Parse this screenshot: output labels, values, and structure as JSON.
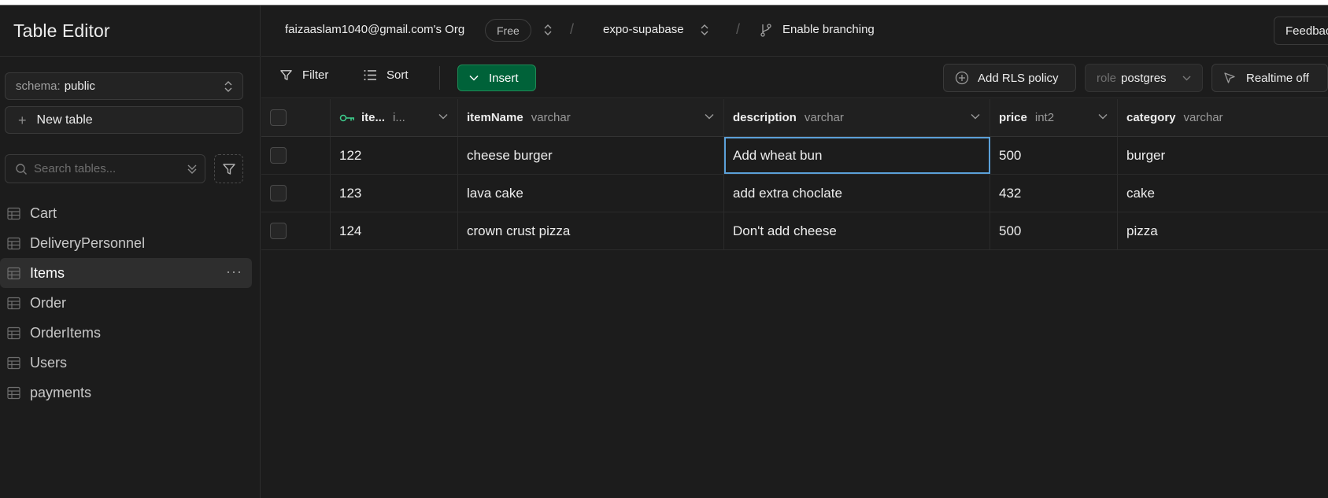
{
  "sidebar": {
    "title": "Table Editor",
    "schema": {
      "label": "schema:",
      "value": "public"
    },
    "new_table_label": "New table",
    "search_placeholder": "Search tables...",
    "tables": [
      {
        "name": "Cart",
        "active": false
      },
      {
        "name": "DeliveryPersonnel",
        "active": false
      },
      {
        "name": "Items",
        "active": true
      },
      {
        "name": "Order",
        "active": false
      },
      {
        "name": "OrderItems",
        "active": false
      },
      {
        "name": "Users",
        "active": false
      },
      {
        "name": "payments",
        "active": false
      }
    ]
  },
  "topbar": {
    "org": "faizaaslam1040@gmail.com's Org",
    "plan_badge": "Free",
    "project": "expo-supabase",
    "branching": "Enable branching",
    "feedback": "Feedback"
  },
  "toolbar": {
    "filter": "Filter",
    "sort": "Sort",
    "insert": "Insert",
    "add_rls": "Add RLS policy",
    "role_label": "role",
    "role_value": "postgres",
    "realtime": "Realtime off"
  },
  "grid": {
    "columns": [
      {
        "name": "ite...",
        "type": "i...",
        "primary_key": true
      },
      {
        "name": "itemName",
        "type": "varchar"
      },
      {
        "name": "description",
        "type": "varchar"
      },
      {
        "name": "price",
        "type": "int2"
      },
      {
        "name": "category",
        "type": "varchar"
      }
    ],
    "rows": [
      [
        "122",
        "cheese burger",
        "Add wheat bun",
        "500",
        "burger"
      ],
      [
        "123",
        "lava cake",
        "add extra choclate",
        "432",
        "cake"
      ],
      [
        "124",
        "crown crust pizza",
        "Don't add cheese",
        "500",
        "pizza"
      ]
    ]
  },
  "colors": {
    "background": "#1c1c1c",
    "accent_green": "#006239",
    "key_green": "#3ecf8e",
    "selection_blue": "#5ba0d8"
  }
}
